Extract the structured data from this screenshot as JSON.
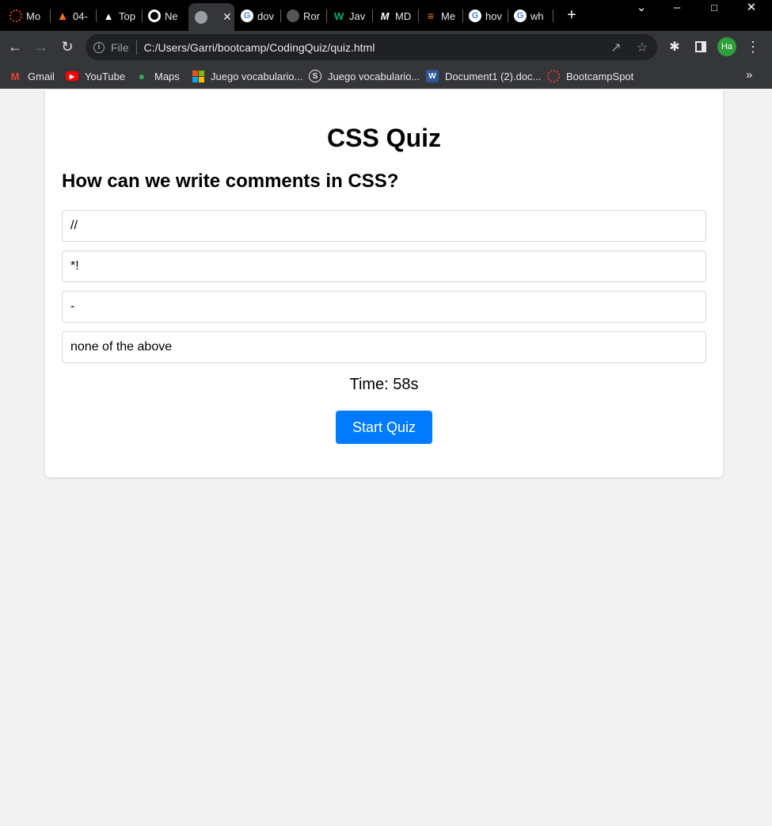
{
  "browser": {
    "tabs": [
      {
        "label": "Mo",
        "icon": "bootcamp-icon",
        "color": "#e03c31"
      },
      {
        "label": "04-",
        "icon": "gitlab-icon",
        "color": "#fc6d26"
      },
      {
        "label": "Top",
        "icon": "mountain-icon",
        "color": "#ffffff"
      },
      {
        "label": "Ne",
        "icon": "chrome-icon",
        "color": "#ffffff"
      },
      {
        "label": "",
        "icon": "globe-icon",
        "color": "#9aa0a6"
      },
      {
        "label": "dov",
        "icon": "google-icon",
        "color": "#ffffff"
      },
      {
        "label": "Ror",
        "icon": "github-icon",
        "color": "#555555"
      },
      {
        "label": "Jav",
        "icon": "w3schools-icon",
        "color": "#04aa6d"
      },
      {
        "label": "MD",
        "icon": "mdn-icon",
        "color": "#ffffff"
      },
      {
        "label": "Me",
        "icon": "stackoverflow-icon",
        "color": "#f48024"
      },
      {
        "label": "hov",
        "icon": "google-icon",
        "color": "#ffffff"
      },
      {
        "label": "wh",
        "icon": "google-icon",
        "color": "#ffffff"
      }
    ],
    "new_tab_symbol": "+",
    "omnibox": {
      "scheme_label": "File",
      "url": "C:/Users/Garri/bootcamp/CodingQuiz/quiz.html"
    },
    "profile_initials": "Ha",
    "bookmarks": [
      {
        "label": "Gmail",
        "icon": "gmail-icon"
      },
      {
        "label": "YouTube",
        "icon": "youtube-icon"
      },
      {
        "label": "Maps",
        "icon": "maps-icon"
      },
      {
        "label": "Juego vocabulario...",
        "icon": "microsoft-icon"
      },
      {
        "label": "Juego vocabulario...",
        "icon": "sway-icon"
      },
      {
        "label": "Document1 (2).doc...",
        "icon": "word-icon"
      },
      {
        "label": "BootcampSpot",
        "icon": "bootcamp-icon"
      }
    ]
  },
  "quiz": {
    "title": "CSS Quiz",
    "question": "How can we write comments in CSS?",
    "choices": [
      "//",
      "*!",
      "-",
      "none of the above"
    ],
    "timer_text": "Time: 58s",
    "start_button": "Start Quiz"
  },
  "colors": {
    "accent": "#007bff",
    "page_background": "#f2f2f2"
  }
}
